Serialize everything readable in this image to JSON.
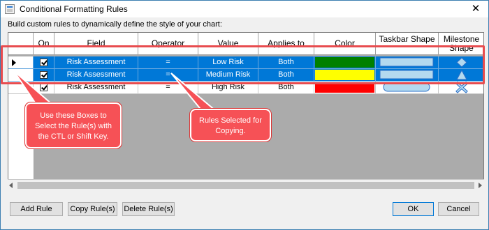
{
  "window": {
    "title": "Conditional Formatting Rules",
    "close_glyph": "✕",
    "subtitle": "Build custom rules to dynamically define the style of your chart:"
  },
  "grid": {
    "headers": {
      "on": "On",
      "field": "Field",
      "operator": "Operator",
      "value": "Value",
      "applies_to": "Applies to",
      "color": "Color",
      "taskbar_shape": "Taskbar Shape",
      "milestone_shape": "Milestone Shape"
    },
    "rows": [
      {
        "selected": true,
        "current": true,
        "on": true,
        "field": "Risk Assessment",
        "operator": "=",
        "value": "Low Risk",
        "applies_to": "Both",
        "color": "#008000",
        "taskbar_shape": "rectangle",
        "milestone_shape": "diamond"
      },
      {
        "selected": true,
        "current": false,
        "on": true,
        "field": "Risk Assessment",
        "operator": "=",
        "value": "Medium Risk",
        "applies_to": "Both",
        "color": "#ffff00",
        "taskbar_shape": "rectangle",
        "milestone_shape": "triangle"
      },
      {
        "selected": false,
        "current": false,
        "on": true,
        "field": "Risk Assessment",
        "operator": "=",
        "value": "High Risk",
        "applies_to": "Both",
        "color": "#ff0000",
        "taskbar_shape": "rounded-rectangle",
        "milestone_shape": "cross"
      }
    ]
  },
  "buttons": {
    "add_rule": "Add Rule",
    "copy_rules": "Copy Rule(s)",
    "delete_rules": "Delete Rule(s)",
    "ok": "OK",
    "cancel": "Cancel"
  },
  "callouts": {
    "boxes": "Use these Boxes to Select the Rule(s) with the CTL or Shift Key.",
    "selected": "Rules Selected for Copying."
  },
  "colors": {
    "selection": "#0078d7",
    "callout": "#f65156",
    "shape_fill": "#b3d9ef",
    "shape_stroke": "#2a6fc9"
  }
}
